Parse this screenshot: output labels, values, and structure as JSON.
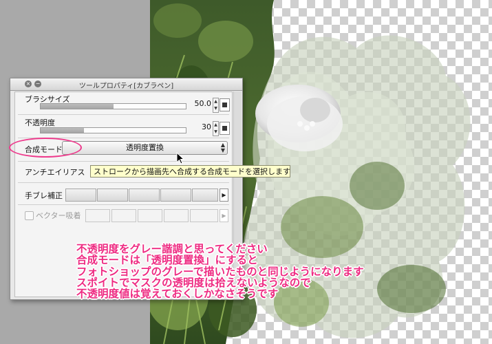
{
  "panel": {
    "title": "ツールプロパティ[カブラペン]",
    "brush_size": {
      "label": "ブラシサイズ",
      "value": "50.0",
      "fill_fraction": 0.5
    },
    "opacity": {
      "label": "不透明度",
      "value": "30",
      "fill_fraction": 0.3
    },
    "blend_mode": {
      "label": "合成モード",
      "selected": "透明度置換"
    },
    "antialias": {
      "label": "アンチエイリアス"
    },
    "stabilizer": {
      "label": "手ブレ補正"
    },
    "vector_snap": {
      "label": "ベクター吸着",
      "checked": false,
      "enabled": false
    }
  },
  "tooltip": {
    "text": "ストロークから描画先へ合成する合成モードを選択します"
  },
  "annotation": {
    "color": "#ee2b82",
    "lines": [
      "不透明度をグレー諧調と思ってください",
      "合成モードは「透明度置換」にすると",
      "フォトショップのグレーで描いたものと同じようになります",
      "スポイトでマスクの透明度は拾えないようなので",
      "不透明度値は覚えておくしかなさそうです"
    ]
  }
}
